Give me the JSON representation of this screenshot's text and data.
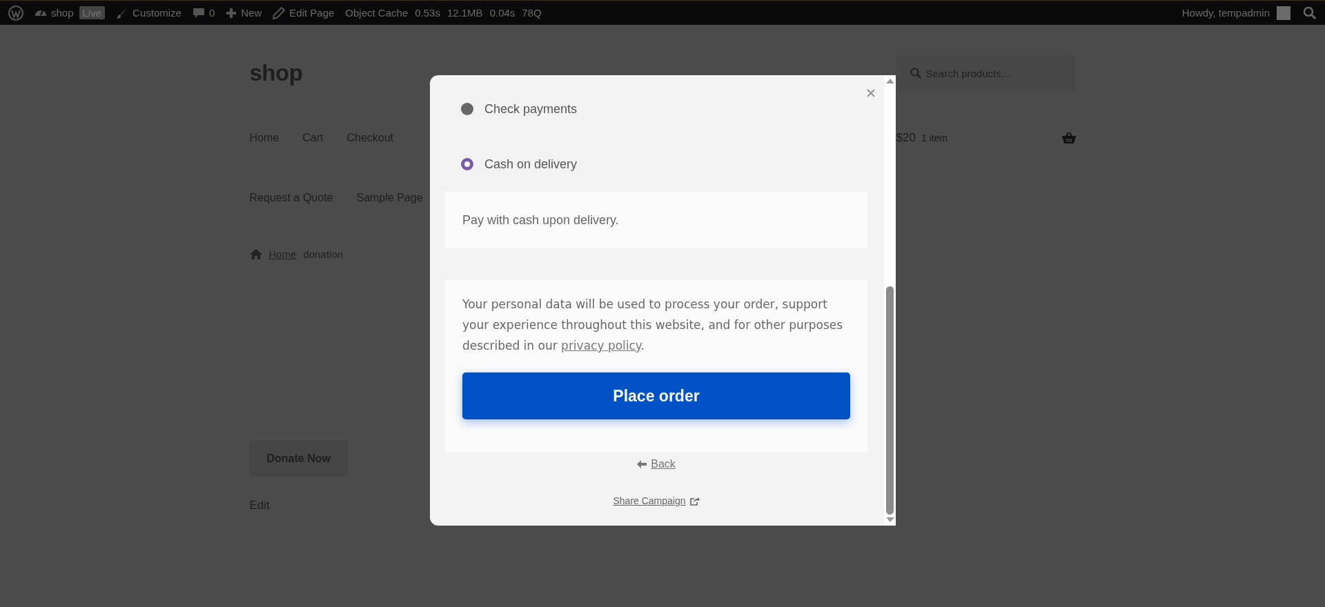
{
  "admin_bar": {
    "items": [
      {
        "kind": "logo"
      },
      {
        "kind": "site",
        "label": "shop"
      },
      {
        "kind": "badge",
        "label": "Live"
      },
      {
        "kind": "customize",
        "label": "Customize"
      },
      {
        "kind": "comments",
        "label": "0"
      },
      {
        "kind": "new",
        "label": "New"
      },
      {
        "kind": "edit",
        "label": "Edit Page"
      },
      {
        "kind": "plain",
        "label": "Object Cache"
      },
      {
        "kind": "perf",
        "label": "0.53s"
      },
      {
        "kind": "perf",
        "label": "12.1MB"
      },
      {
        "kind": "perf",
        "label": "0.04s"
      },
      {
        "kind": "perf",
        "label": "78Q"
      }
    ],
    "greeting": "Howdy, tempadmin"
  },
  "site": {
    "title": "shop",
    "search": {
      "placeholder": "Search products…"
    },
    "nav_rows": [
      [
        "Home",
        "Cart",
        "Checkout"
      ],
      [
        "Request a Quote",
        "Sample Page"
      ]
    ],
    "cart": {
      "amount": "$20",
      "count": "1 item"
    },
    "breadcrumb": {
      "home": "Home",
      "current": "donation"
    },
    "donate_button": "Donate Now",
    "edit_link": "Edit"
  },
  "modal": {
    "payment_methods": [
      {
        "label": "Check payments",
        "selected": false
      },
      {
        "label": "Cash on delivery",
        "selected": true
      }
    ],
    "description": "Pay with cash upon delivery.",
    "privacy": {
      "before": "Your personal data will be used to process your order, support your experience throughout this website, and for other purposes described in our ",
      "link": "privacy policy",
      "after": "."
    },
    "place_order": "Place order",
    "back": "Back",
    "share": "Share Campaign"
  }
}
